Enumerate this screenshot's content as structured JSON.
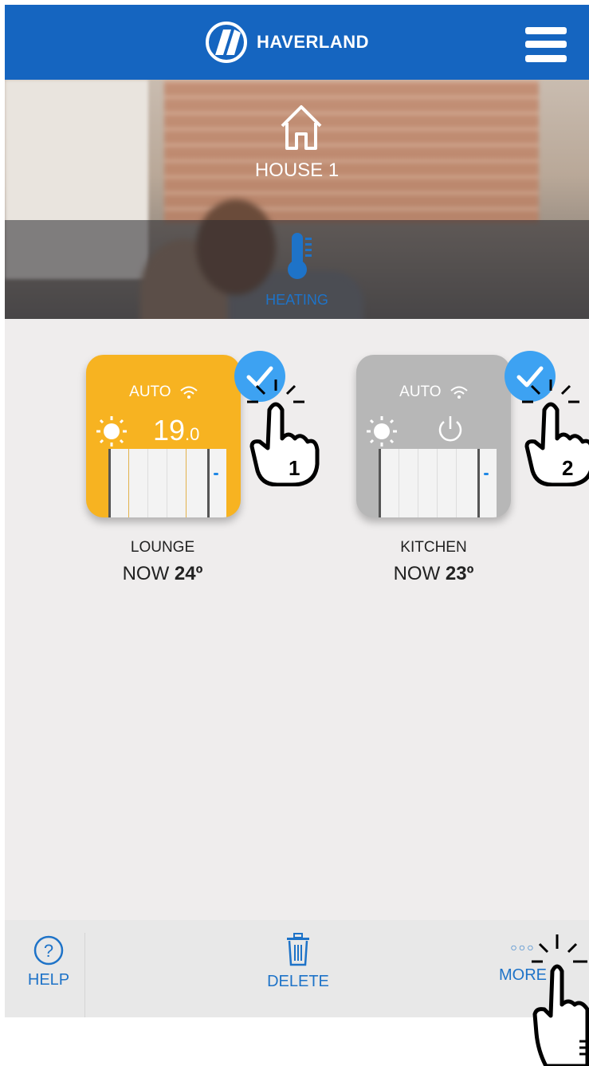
{
  "header": {
    "brand": "HAVERLAND"
  },
  "hero": {
    "house_label": "HOUSE 1",
    "section_label": "HEATING"
  },
  "devices": [
    {
      "mode": "AUTO",
      "setpoint_int": "19",
      "setpoint_dec": ".0",
      "name": "LOUNGE",
      "now_prefix": "NOW",
      "now_temp": "24º",
      "card_color": "#f7b321",
      "selected": true,
      "badge": "1"
    },
    {
      "mode": "AUTO",
      "name": "KITCHEN",
      "now_prefix": "NOW",
      "now_temp": "23º",
      "card_color": "#b7b7b7",
      "selected": true,
      "badge": "2"
    }
  ],
  "bottombar": {
    "help_label": "HELP",
    "delete_label": "DELETE",
    "more_label": "MORE",
    "more_glyph": "○○○"
  },
  "colors": {
    "header": "#1565c0",
    "accent": "#1e73c8",
    "check": "#3da2f2"
  },
  "icons": [
    "haverland-logo",
    "hamburger-menu-icon",
    "house-icon",
    "thermometer-icon",
    "sun-icon",
    "wifi-icon",
    "power-icon",
    "check-icon",
    "help-icon",
    "trash-icon",
    "more-icon",
    "tap-hand-icon"
  ]
}
